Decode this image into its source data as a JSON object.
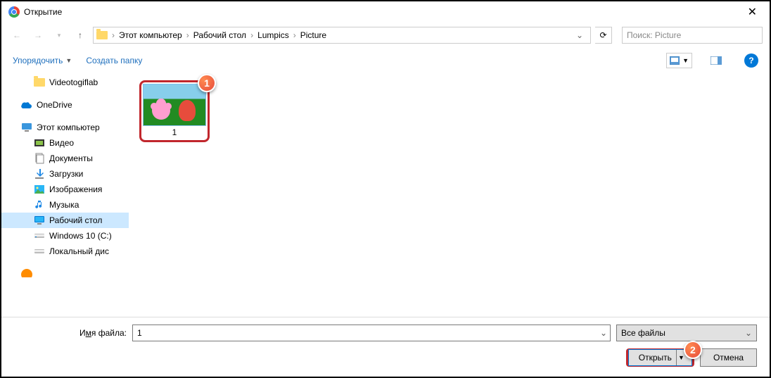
{
  "title": "Открытие",
  "nav": {
    "back": "←",
    "fwd": "→",
    "up": "↑"
  },
  "breadcrumb": [
    "Этот компьютер",
    "Рабочий стол",
    "Lumpics",
    "Picture"
  ],
  "search_placeholder": "Поиск: Picture",
  "toolbar": {
    "organize": "Упорядочить",
    "new_folder": "Создать папку"
  },
  "tree": {
    "videotogiflab": "Videotogiflab",
    "onedrive": "OneDrive",
    "this_pc": "Этот компьютер",
    "video": "Видео",
    "documents": "Документы",
    "downloads": "Загрузки",
    "pictures": "Изображения",
    "music": "Музыка",
    "desktop": "Рабочий стол",
    "win10": "Windows 10 (C:)",
    "localdisk": "Локальный дис"
  },
  "file": {
    "name": "1"
  },
  "footer": {
    "label_prefix": "И",
    "label_underline": "м",
    "label_suffix": "я файла:",
    "filter": "Все файлы",
    "open": "Открыть",
    "cancel": "Отмена"
  },
  "markers": {
    "one": "1",
    "two": "2"
  }
}
